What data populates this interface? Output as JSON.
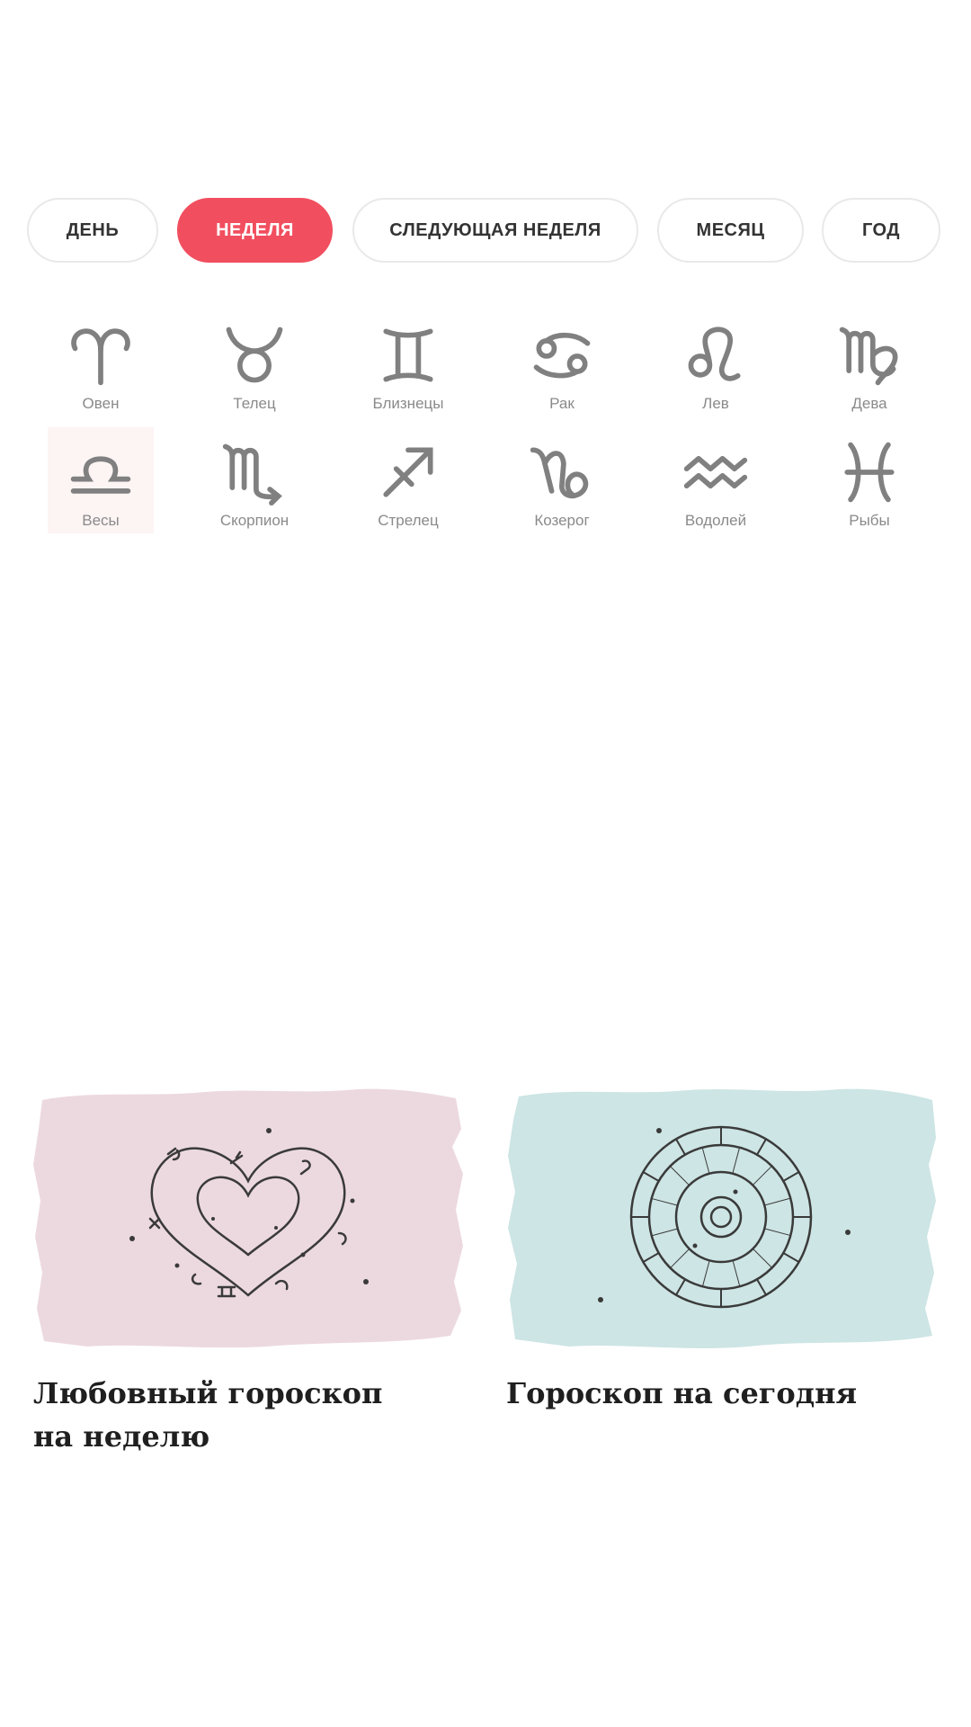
{
  "period_tabs": [
    {
      "label": "ДЕНЬ",
      "active": false
    },
    {
      "label": "НЕДЕЛЯ",
      "active": true
    },
    {
      "label": "СЛЕДУЮЩАЯ НЕДЕЛЯ",
      "active": false
    },
    {
      "label": "МЕСЯЦ",
      "active": false
    },
    {
      "label": "ГОД",
      "active": false
    }
  ],
  "zodiac_signs": [
    {
      "label": "Овен",
      "icon": "aries-icon",
      "glyph": "♈"
    },
    {
      "label": "Телец",
      "icon": "taurus-icon",
      "glyph": "♉"
    },
    {
      "label": "Близнецы",
      "icon": "gemini-icon",
      "glyph": "♊"
    },
    {
      "label": "Рак",
      "icon": "cancer-icon",
      "glyph": "♋"
    },
    {
      "label": "Лев",
      "icon": "leo-icon",
      "glyph": "♌"
    },
    {
      "label": "Дева",
      "icon": "virgo-icon",
      "glyph": "♍"
    },
    {
      "label": "Весы",
      "icon": "libra-icon",
      "glyph": "♎",
      "selected": true
    },
    {
      "label": "Скорпион",
      "icon": "scorpio-icon",
      "glyph": "♏"
    },
    {
      "label": "Стрелец",
      "icon": "sagittarius-icon",
      "glyph": "♐"
    },
    {
      "label": "Козерог",
      "icon": "capricorn-icon",
      "glyph": "♑"
    },
    {
      "label": "Водолей",
      "icon": "aquarius-icon",
      "glyph": "♒"
    },
    {
      "label": "Рыбы",
      "icon": "pisces-icon",
      "glyph": "♓"
    }
  ],
  "cards": [
    {
      "title": "Любовный гороскоп на неделю",
      "bg_color": "#ecd9df",
      "illustration": "zodiac-heart-illustration"
    },
    {
      "title": "Гороскоп на сегодня",
      "bg_color": "#cde5e4",
      "illustration": "zodiac-wheel-illustration"
    }
  ],
  "colors": {
    "accent": "#f14f5f",
    "icon": "#808080",
    "label": "#8a8a8a",
    "tab_border": "#e9e9e9"
  }
}
